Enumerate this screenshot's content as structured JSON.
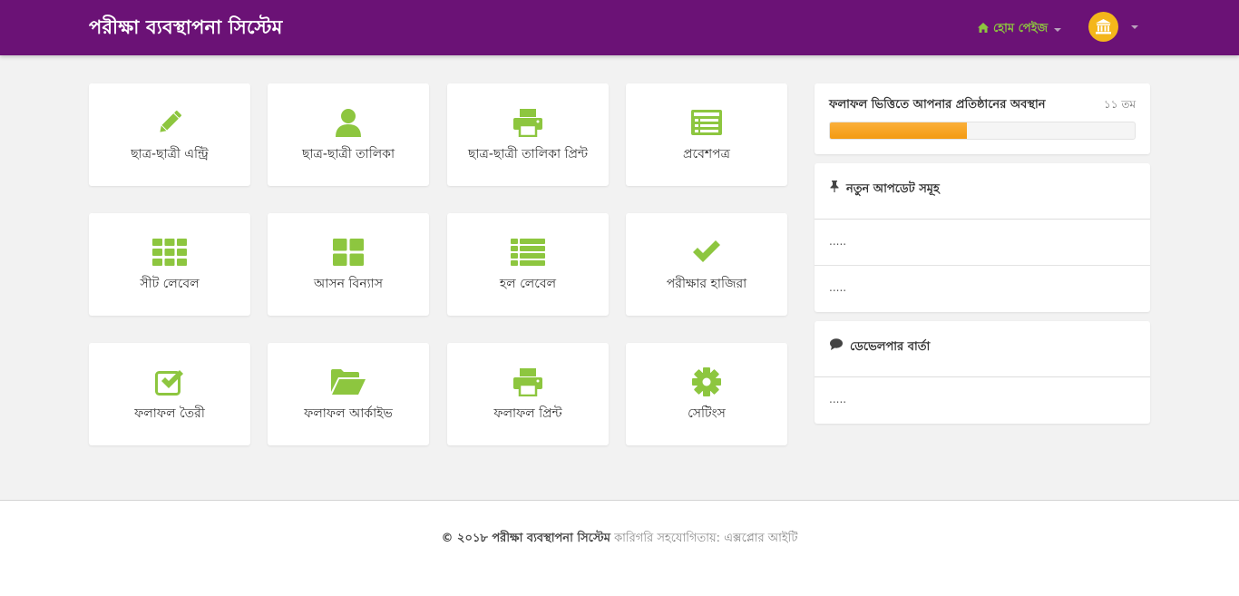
{
  "header": {
    "brand": "পরীক্ষা ব্যবস্থাপনা সিস্টেম",
    "home_label": "হোম পেইজ",
    "home_icon": "home-icon",
    "avatar_icon": "institution-icon"
  },
  "colors": {
    "navbar": "#6b1276",
    "icon_green": "#8dc63f",
    "progress": "#f7a123",
    "avatar": "#f4b61a"
  },
  "tiles": [
    {
      "label": "ছাত্র-ছাত্রী এন্ট্রি",
      "icon": "pencil-icon"
    },
    {
      "label": "ছাত্র-ছাত্রী তালিকা",
      "icon": "user-icon"
    },
    {
      "label": "ছাত্র-ছাত্রী তালিকা প্রিন্ট",
      "icon": "printer-icon"
    },
    {
      "label": "প্রবেশপত্র",
      "icon": "id-card-icon"
    },
    {
      "label": "সীট লেবেল",
      "icon": "grid-icon"
    },
    {
      "label": "আসন বিন্যাস",
      "icon": "large-grid-icon"
    },
    {
      "label": "হল লেবেল",
      "icon": "list-icon"
    },
    {
      "label": "পরীক্ষার হাজিরা",
      "icon": "check-icon"
    },
    {
      "label": "ফলাফল তৈরী",
      "icon": "checkbox-icon"
    },
    {
      "label": "ফলাফল আর্কাইভ",
      "icon": "folder-open-icon"
    },
    {
      "label": "ফলাফল প্রিন্ট",
      "icon": "printer-icon"
    },
    {
      "label": "সেটিংস",
      "icon": "gear-icon"
    }
  ],
  "rank": {
    "title": "ফলাফল ভিত্তিতে আপনার প্রতিষ্ঠানের অবস্থান",
    "value": "১১ তম",
    "progress_fraction": 0.45
  },
  "updates": {
    "title": "নতুন আপডেট সমূহ",
    "icon": "pin-icon",
    "items": [
      ".....",
      "....."
    ]
  },
  "developer": {
    "title": "ডেভেলপার বার্তা",
    "icon": "comment-icon",
    "items": [
      "....."
    ]
  },
  "footer": {
    "copyright": "© ২০১৮ পরীক্ষা ব্যবস্থাপনা সিস্টেম",
    "credit": "কারিগরি সহযোগিতায়: এক্সপ্লোর আইটি"
  }
}
